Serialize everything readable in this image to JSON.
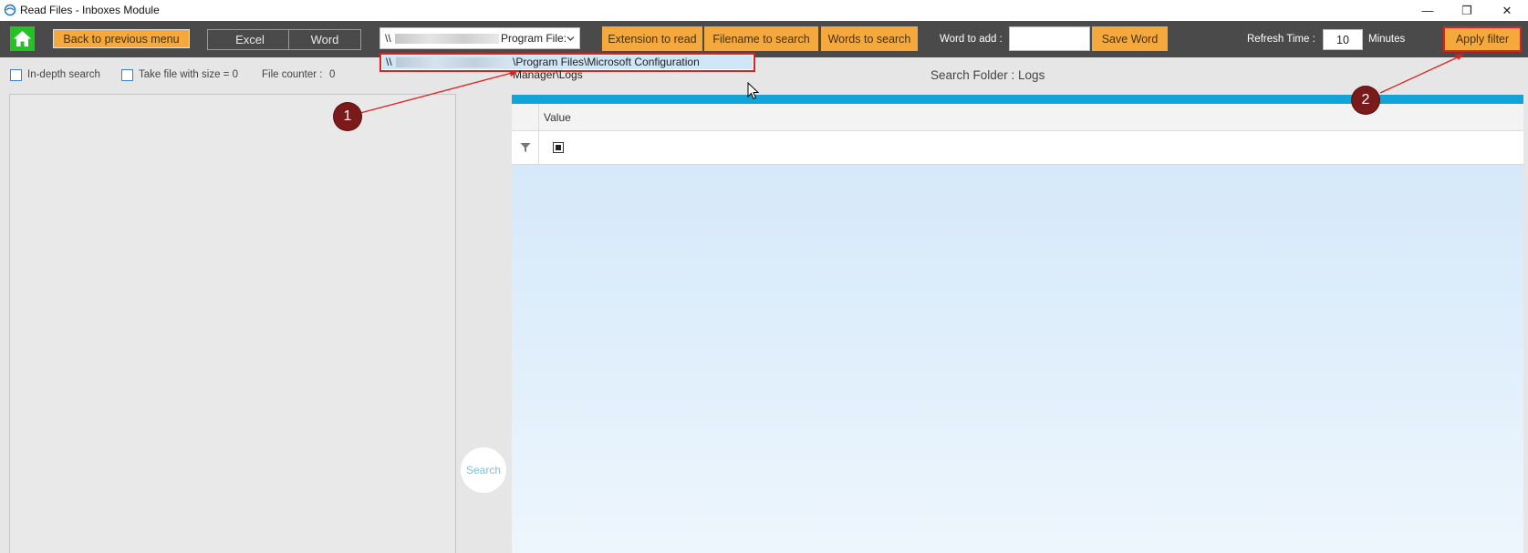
{
  "window": {
    "title": "Read Files - Inboxes Module",
    "minimize_glyph": "—",
    "restore_glyph": "❐",
    "close_glyph": "✕"
  },
  "toolbar": {
    "back_label": "Back to previous menu",
    "excel_label": "Excel",
    "word_label": "Word",
    "path_prefix": "\\\\",
    "path_suffix": "Program File:",
    "extension_label": "Extension to read",
    "filename_label": "Filename to search",
    "words_label": "Words to search",
    "word_to_add_label": "Word to add :",
    "word_to_add_value": "",
    "save_word_label": "Save Word",
    "refresh_label": "Refresh Time :",
    "refresh_value": "10",
    "minutes_label": "Minutes",
    "apply_filter_label": "Apply filter"
  },
  "dropdown": {
    "option_prefix": "\\\\",
    "option_suffix": "\\Program Files\\Microsoft Configuration Manager\\Logs"
  },
  "options": {
    "indepth_label": "In-depth search",
    "take_file_label": "Take file with size = 0",
    "file_counter_label": "File counter :",
    "file_counter_value": "0"
  },
  "search_folder_text": "Search Folder : Logs",
  "grid": {
    "column_header": "Value"
  },
  "search_button_label": "Search",
  "annotations": {
    "marker1": "1",
    "marker2": "2"
  },
  "colors": {
    "accent_orange": "#f5a93d",
    "toolbar_dark": "#4a4a4a",
    "strip_blue": "#12a4d8",
    "home_green": "#22c322",
    "highlight_red": "#e02020"
  }
}
